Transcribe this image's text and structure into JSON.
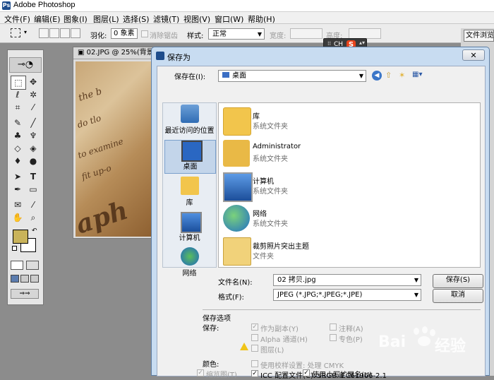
{
  "app": {
    "title": "Adobe Photoshop",
    "logo_letters": "Ps"
  },
  "menu": [
    "文件(F)",
    "编辑(E)",
    "图象(I)",
    "图层(L)",
    "选择(S)",
    "滤镜(T)",
    "视图(V)",
    "窗口(W)",
    "帮助(H)"
  ],
  "options": {
    "feather_label": "羽化:",
    "feather_value": "0 象素",
    "antialias_label": "消除锯齿",
    "style_label": "样式:",
    "style_value": "正常",
    "width_label": "宽度:",
    "height_label": "高度:",
    "right_button": "文件浏览"
  },
  "ime": {
    "text": "CH",
    "logo": "S"
  },
  "document": {
    "title": "02.JPG @ 25%(背景"
  },
  "dialog": {
    "title": "保存为",
    "close": "✕",
    "save_in_label": "保存在(I):",
    "save_in_value": "桌面",
    "places": [
      {
        "label": "最近访问的位置",
        "icon": "recent-places-icon"
      },
      {
        "label": "桌面",
        "icon": "desktop-icon"
      },
      {
        "label": "库",
        "icon": "library-icon"
      },
      {
        "label": "计算机",
        "icon": "computer-icon"
      },
      {
        "label": "网络",
        "icon": "network-icon"
      }
    ],
    "files": [
      {
        "name": "库",
        "sub": "系统文件夹",
        "icon": "library-folder-icon"
      },
      {
        "name": "Administrator",
        "sub": "系统文件夹",
        "icon": "user-folder-icon"
      },
      {
        "name": "计算机",
        "sub": "系统文件夹",
        "icon": "computer-icon"
      },
      {
        "name": "网络",
        "sub": "系统文件夹",
        "icon": "network-globe-icon"
      },
      {
        "name": "裁剪照片突出主题",
        "sub": "文件夹",
        "icon": "folder-icon"
      }
    ],
    "filename_label": "文件名(N):",
    "filename_value": "02 拷贝.jpg",
    "format_label": "格式(F):",
    "format_value": "JPEG (*.JPG;*.JPEG;*.JPE)",
    "save_button": "保存(S)",
    "cancel_button": "取消",
    "save_options_title": "保存选项",
    "save_label": "保存:",
    "opt_copy": "作为副本(Y)",
    "opt_alpha": "Alpha 通道(H)",
    "opt_layers": "图层(L)",
    "opt_annotation": "注释(A)",
    "opt_spot": "专色(P)",
    "color_label": "颜色:",
    "opt_proof": "使用校样设置: 处理 CMYK",
    "opt_icc": "ICC 配置文件(C): sRGB IEC61966-2.1",
    "opt_thumbnail": "缩览图(T)",
    "opt_lowercase": "使用小写扩展名(U)"
  },
  "watermark": {
    "text1": "Bai",
    "text2": "经验"
  },
  "colors": {
    "accent": "#1f4d8c",
    "dialog_frame": "#c8dcf1",
    "fg_swatch": "#c9b35a"
  }
}
